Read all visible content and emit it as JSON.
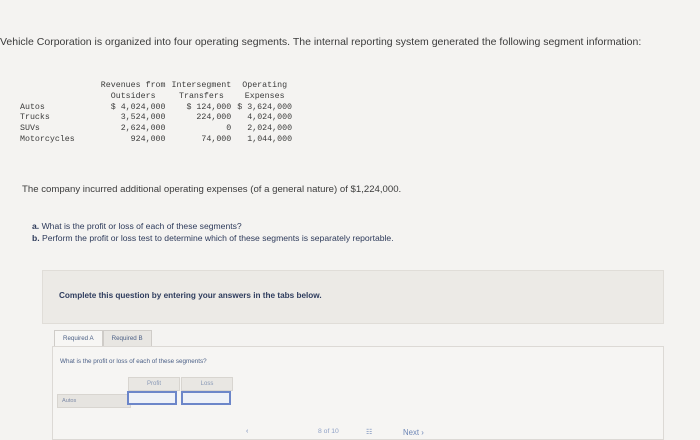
{
  "intro": "Vehicle Corporation is organized into four operating segments. The internal reporting system generated the following segment information:",
  "table": {
    "headers": [
      [
        "",
        "Revenues from",
        "Intersegment",
        "Operating"
      ],
      [
        "",
        "Outsiders",
        "Transfers",
        "Expenses"
      ]
    ],
    "rows": [
      [
        "Autos",
        "$ 4,024,000",
        "$ 124,000",
        "$ 3,624,000"
      ],
      [
        "Trucks",
        "3,524,000",
        "224,000",
        "4,024,000"
      ],
      [
        "SUVs",
        "2,624,000",
        "0",
        "2,024,000"
      ],
      [
        "Motorcycles",
        "924,000",
        "74,000",
        "1,044,000"
      ]
    ]
  },
  "sentence": "The company incurred additional operating expenses (of a general nature) of $1,224,000.",
  "questions": [
    {
      "letter": "a.",
      "text": "What is the profit or loss of each of these segments?"
    },
    {
      "letter": "b.",
      "text": "Perform the profit or loss test to determine which of these segments is separately reportable."
    }
  ],
  "task": "Complete this question by entering your answers in the tabs below.",
  "tabs": [
    "Required A",
    "Required B"
  ],
  "prompt": "What is the profit or loss of each of these segments?",
  "answer_grid": {
    "columns": [
      "Profit",
      "Loss"
    ],
    "rows": [
      "Autos"
    ]
  },
  "footer": {
    "pages": "8 of 10",
    "next": "Next"
  }
}
